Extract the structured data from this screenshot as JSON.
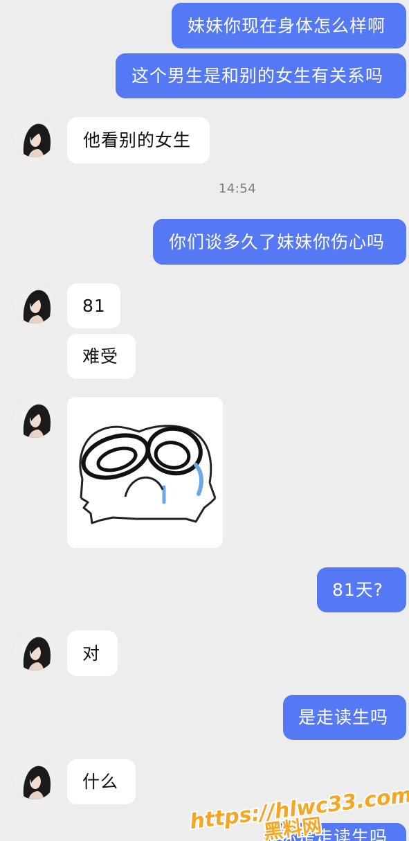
{
  "chat": {
    "messages": [
      {
        "id": 1,
        "direction": "out",
        "text": "妹妹你现在身体怎么样啊"
      },
      {
        "id": 2,
        "direction": "out",
        "text": "这个男生是和别的女生有关系吗"
      },
      {
        "id": 3,
        "direction": "in",
        "text": "他看别的女生"
      },
      {
        "id": 4,
        "direction": "out",
        "text": "你们谈多久了妹妹你伤心吗"
      },
      {
        "id": 5,
        "direction": "in",
        "text": "81"
      },
      {
        "id": 6,
        "direction": "in",
        "text": "难受"
      },
      {
        "id": 7,
        "direction": "in",
        "type": "sticker",
        "sticker": "crying-face-sticker"
      },
      {
        "id": 8,
        "direction": "out",
        "text": "81天?"
      },
      {
        "id": 9,
        "direction": "in",
        "text": "对"
      },
      {
        "id": 10,
        "direction": "out",
        "text": "是走读生吗"
      },
      {
        "id": 11,
        "direction": "in",
        "text": "什么"
      },
      {
        "id": 12,
        "direction": "out",
        "text": "你是走读生吗"
      }
    ],
    "timestamp": "14:54"
  },
  "colors": {
    "background": "#ededed",
    "outgoing_bubble": "#5578f5",
    "incoming_bubble": "#ffffff",
    "watermark": "#f5a623"
  },
  "watermark": {
    "url": "https://hlwc33.com",
    "label": "黑料网"
  }
}
